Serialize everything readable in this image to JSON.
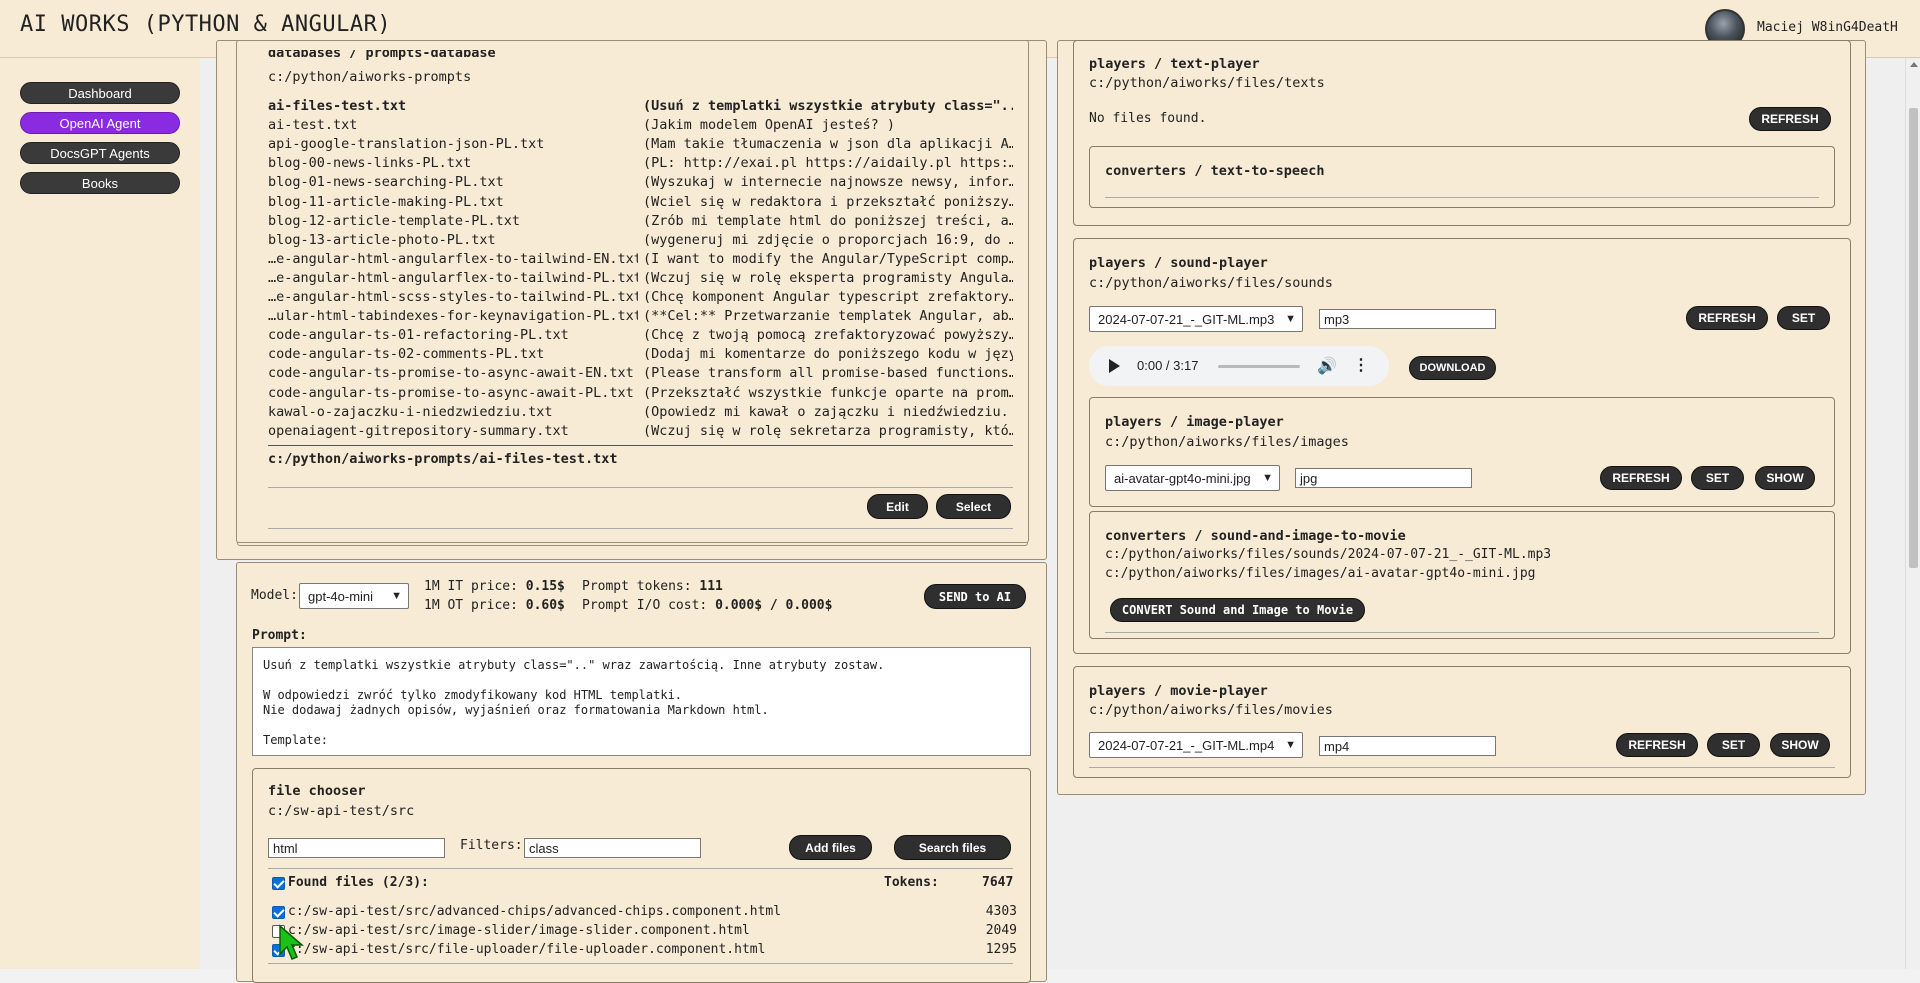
{
  "app": {
    "title": "AI WORKS (PYTHON & ANGULAR)",
    "user_name": "Maciej W8inG4DeatH"
  },
  "nav": [
    {
      "label": "Dashboard",
      "active": false
    },
    {
      "label": "OpenAI Agent",
      "active": true
    },
    {
      "label": "DocsGPT Agents",
      "active": false
    },
    {
      "label": "Books",
      "active": false
    }
  ],
  "prompts_panel": {
    "title": "databases / prompts-database",
    "path": "c:/python/aiworks-prompts",
    "rows": [
      {
        "name": "ai-files-test.txt",
        "desc": "(Usuń z templatki wszystkie atrybuty class=\"..",
        "selected": true
      },
      {
        "name": "ai-test.txt",
        "desc": "(Jakim modelem OpenAI jesteś?                  )"
      },
      {
        "name": "api-google-translation-json-PL.txt",
        "desc": "(Mam takie tłumaczenia w json dla aplikacji A…"
      },
      {
        "name": "blog-00-news-links-PL.txt",
        "desc": "(PL: http://exai.pl https://aidaily.pl https:…"
      },
      {
        "name": "blog-01-news-searching-PL.txt",
        "desc": "(Wyszukaj w internecie najnowsze newsy, infor…"
      },
      {
        "name": "blog-11-article-making-PL.txt",
        "desc": "(Wciel się w redaktora i przekształć poniższy…"
      },
      {
        "name": "blog-12-article-template-PL.txt",
        "desc": "(Zrób mi template html do poniższej treści, a…"
      },
      {
        "name": "blog-13-article-photo-PL.txt",
        "desc": "(wygeneruj mi zdjęcie o proporcjach 16:9, do …"
      },
      {
        "name": "…e-angular-html-angularflex-to-tailwind-EN.txt",
        "desc": "(I want to modify the Angular/TypeScript comp…"
      },
      {
        "name": "…e-angular-html-angularflex-to-tailwind-PL.txt",
        "desc": "(Wczuj się w rolę eksperta programisty Angula…"
      },
      {
        "name": "…e-angular-html-scss-styles-to-tailwind-PL.txt",
        "desc": "(Chcę komponent Angular typescript zrefaktory…"
      },
      {
        "name": "…ular-html-tabindexes-for-keynavigation-PL.txt",
        "desc": "(**Cel:** Przetwarzanie templatek Angular, ab…"
      },
      {
        "name": "code-angular-ts-01-refactoring-PL.txt",
        "desc": "(Chcę z twoją pomocą zrefaktoryzować powyższy…"
      },
      {
        "name": "code-angular-ts-02-comments-PL.txt",
        "desc": "(Dodaj mi komentarze do poniższego kodu w języ…"
      },
      {
        "name": "code-angular-ts-promise-to-async-await-EN.txt",
        "desc": "(Please transform all promise-based functions…"
      },
      {
        "name": "code-angular-ts-promise-to-async-await-PL.txt",
        "desc": "(Przekształć wszystkie funkcje oparte na prom…"
      },
      {
        "name": "kawal-o-zajaczku-i-niedzwiedziu.txt",
        "desc": "(Opowiedz mi kawał o zajączku i niedźwiedziu. )"
      },
      {
        "name": "openaiagent-gitrepository-summary.txt",
        "desc": "(Wczuj się w rolę sekretarza programisty, któ…"
      }
    ],
    "selected_path": "c:/python/aiworks-prompts/ai-files-test.txt",
    "edit_label": "Edit",
    "select_label": "Select"
  },
  "model_panel": {
    "model_label": "Model:",
    "model_value": "gpt-4o-mini",
    "it_price_label": "1M IT price:",
    "it_price": "0.15$",
    "ot_price_label": "1M OT price:",
    "ot_price": "0.60$",
    "prompt_tokens_label": "Prompt tokens:",
    "prompt_tokens": "111",
    "io_cost_label": "Prompt I/O cost:",
    "io_cost": "0.000$ / 0.000$",
    "send_label": "SEND to AI",
    "prompt_label": "Prompt:",
    "prompt_text": "Usuń z templatki wszystkie atrybuty class=\"..\" wraz zawartością. Inne atrybuty zostaw.\n\nW odpowiedzi zwróć tylko zmodyfikowany kod HTML templatki.\nNie dodawaj żadnych opisów, wyjaśnień oraz formatowania Markdown html.\n\nTemplate:"
  },
  "file_chooser": {
    "title": "file chooser",
    "path": "c:/sw-api-test/src",
    "ext_value": "html",
    "filters_label": "Filters:",
    "filters_value": "class",
    "add_label": "Add files",
    "search_label": "Search files",
    "found_label": "Found files (2/3):",
    "tokens_label": "Tokens:",
    "tokens_total": "7647",
    "files": [
      {
        "path": "c:/sw-api-test/src/advanced-chips/advanced-chips.component.html",
        "tokens": "4303",
        "checked": true
      },
      {
        "path": "c:/sw-api-test/src/image-slider/image-slider.component.html",
        "tokens": "2049",
        "checked": false
      },
      {
        "path": "c:/sw-api-test/src/file-uploader/file-uploader.component.html",
        "tokens": "1295",
        "checked": true
      }
    ]
  },
  "text_player": {
    "title": "players / text-player",
    "path": "c:/python/aiworks/files/texts",
    "empty": "No files found.",
    "refresh_label": "REFRESH",
    "tts_title": "converters / text-to-speech"
  },
  "sound_player": {
    "title": "players / sound-player",
    "path": "c:/python/aiworks/files/sounds",
    "select_value": "2024-07-07-21_-_GIT-ML.mp3",
    "ext_value": "mp3",
    "refresh_label": "REFRESH",
    "set_label": "SET",
    "time": "0:00 / 3:17",
    "download_label": "DOWNLOAD"
  },
  "image_player": {
    "title": "players / image-player",
    "path": "c:/python/aiworks/files/images",
    "select_value": "ai-avatar-gpt4o-mini.jpg",
    "ext_value": "jpg",
    "refresh_label": "REFRESH",
    "set_label": "SET",
    "show_label": "SHOW"
  },
  "movie_converter": {
    "title": "converters / sound-and-image-to-movie",
    "sound_path": "c:/python/aiworks/files/sounds/2024-07-07-21_-_GIT-ML.mp3",
    "image_path": "c:/python/aiworks/files/images/ai-avatar-gpt4o-mini.jpg",
    "convert_label": "CONVERT Sound and Image to Movie"
  },
  "movie_player": {
    "title": "players / movie-player",
    "path": "c:/python/aiworks/files/movies",
    "select_value": "2024-07-07-21_-_GIT-ML.mp4",
    "ext_value": "mp4",
    "refresh_label": "REFRESH",
    "set_label": "SET",
    "show_label": "SHOW"
  },
  "icons": {
    "play": "play-icon",
    "volume": "volume-icon",
    "more": "more-vert-icon",
    "cursor": "mouse-cursor-icon",
    "avatar": "user-avatar"
  },
  "colors": {
    "panel_bg": "#f8ebd6",
    "active_nav": "#8a2be2",
    "pill_bg": "#2f2f2f",
    "checkbox": "#0b6fd6"
  }
}
